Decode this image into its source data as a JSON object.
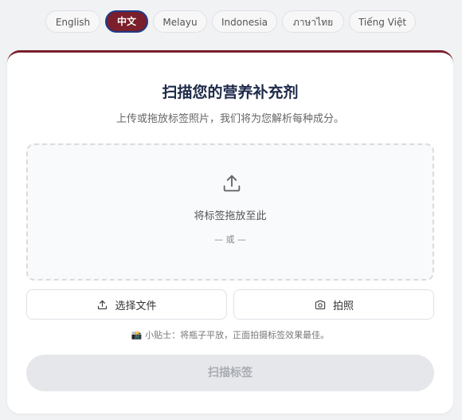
{
  "languages": [
    {
      "label": "English",
      "active": false
    },
    {
      "label": "中文",
      "active": true
    },
    {
      "label": "Melayu",
      "active": false
    },
    {
      "label": "Indonesia",
      "active": false
    },
    {
      "label": "ภาษาไทย",
      "active": false
    },
    {
      "label": "Tiếng Việt",
      "active": false
    }
  ],
  "header": {
    "title": "扫描您的营养补充剂",
    "subtitle": "上传或拖放标签照片，我们将为您解析每种成分。"
  },
  "dropzone": {
    "icon": "upload-icon",
    "text": "将标签拖放至此",
    "or": "— 或 —"
  },
  "actions": {
    "choose_file": "选择文件",
    "choose_file_icon": "upload-icon",
    "take_photo": "拍照",
    "take_photo_icon": "camera-icon"
  },
  "tip": "📸 小贴士：将瓶子平放，正面拍摄标签效果最佳。",
  "scan_button": "扫描标签",
  "colors": {
    "accent": "#7a1f2b",
    "active_border": "#1e3a8a",
    "title": "#1e2a4a",
    "disabled_bg": "#e6e7ea"
  }
}
